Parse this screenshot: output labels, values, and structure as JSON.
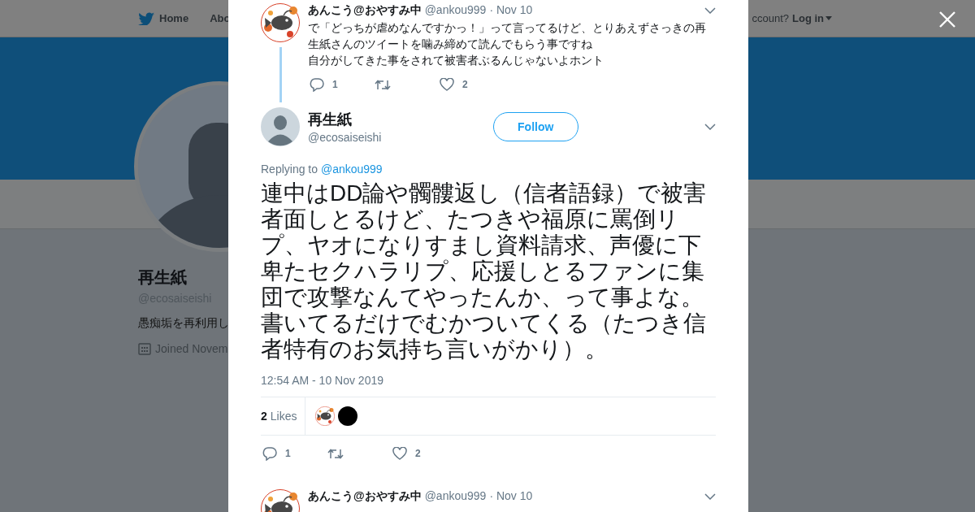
{
  "header": {
    "nav": [
      {
        "label": "Home",
        "kind": "home"
      },
      {
        "label": "Abo",
        "kind": "plain"
      }
    ],
    "account_prompt": "ccount?",
    "login": "Log in"
  },
  "profile": {
    "name": "再生紙",
    "handle": "@ecosaiseishi",
    "bio": "愚痴垢を再利用し",
    "joined": "Joined Novem"
  },
  "modal": {
    "parent_tweet": {
      "name": "あんこう@おやすみ中",
      "handle": "@ankou999",
      "date": "· Nov 10",
      "kind": "fish",
      "paragraphs": [
        "で「どっちが虐めなんですかっ！」って言ってるけど、とりあえずさっきの再生紙さんのツイートを噛み締めて読んでもらう事ですね",
        "自分がしてきた事をされて被害者ぶるんじゃないよホント"
      ],
      "replies": "1",
      "likes": "2"
    },
    "tweet": {
      "name": "再生紙",
      "handle": "@ecosaiseishi",
      "kind": "default",
      "follow": "Follow",
      "replying_prefix": "Replying to",
      "replying_to": "@ankou999",
      "paragraphs": [
        "連中はDD論や髑髏返し（信者語録）で被害者面しとるけど、たつきや福原に罵倒リプ、ヤオになりすまし資料請求、声優に下卑たセクハラリプ、応援しとるファンに集団で攻撃なんてやったんか、って事よな。",
        "書いてるだけでむかついてくる（たつき信者特有のお気持ち言いがかり）。"
      ],
      "timestamp": "12:54 AM - 10 Nov 2019",
      "like_count": "2",
      "likes_label": "Likes",
      "likers": [
        {
          "kind": "fish"
        },
        {
          "kind": "black"
        }
      ],
      "replies": "1",
      "likes": "2"
    },
    "next_tweet": {
      "name": "あんこう@おやすみ中",
      "handle": "@ankou999",
      "date": "· Nov 10",
      "kind": "fish"
    }
  }
}
